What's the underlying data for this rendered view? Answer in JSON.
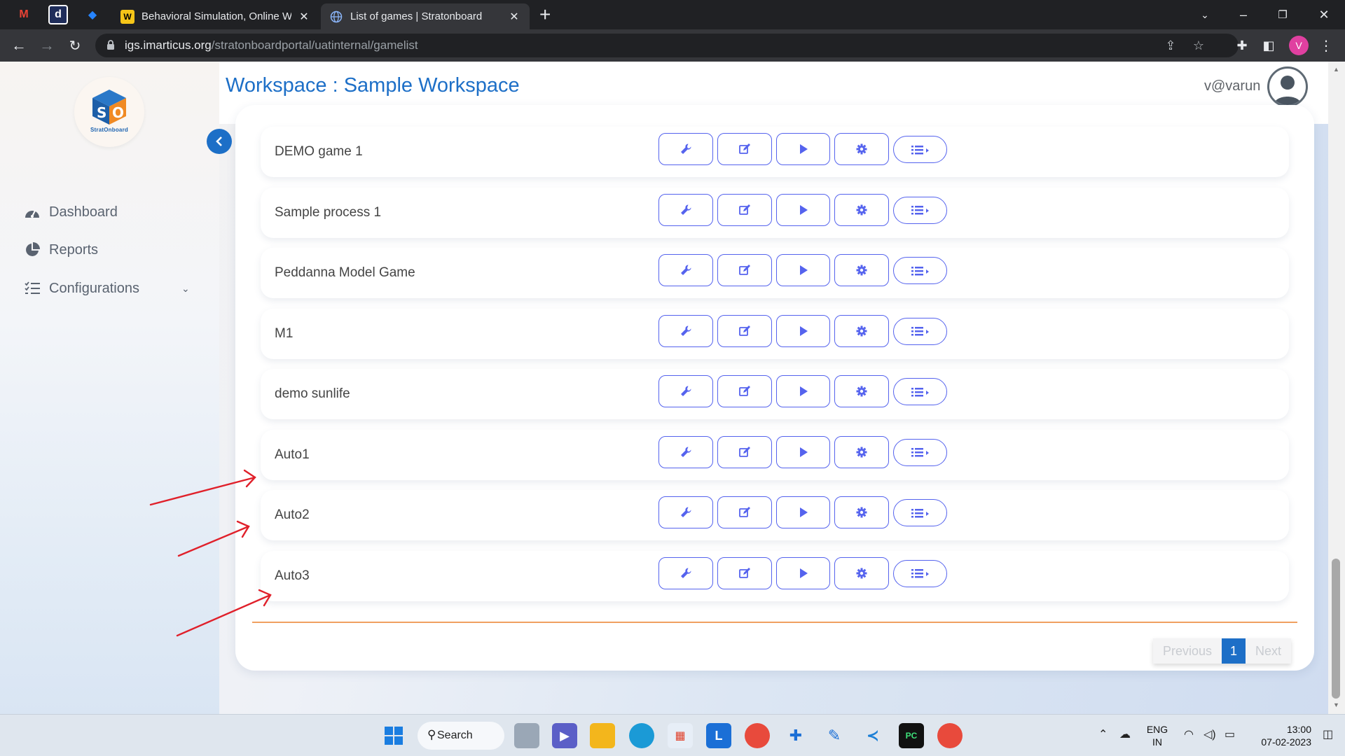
{
  "browser": {
    "pinned_tabs": [
      {
        "name": "gmail-icon",
        "glyph": "M",
        "color": "#ea4335"
      },
      {
        "name": "d-icon",
        "glyph": "d",
        "color": "#1f2d5a"
      },
      {
        "name": "jira-icon",
        "glyph": "◆",
        "color": "#2684ff"
      }
    ],
    "tabs": [
      {
        "title": "Behavioral Simulation, Online Wh",
        "close": "✕"
      },
      {
        "title": "List of games | Stratonboard",
        "close": "✕"
      }
    ],
    "new_tab": "+",
    "url_host": "igs.imarticus.org",
    "url_path": "/stratonboardportal/uatinternal/gamelist",
    "profile_initial": "V"
  },
  "app": {
    "brand": "StratOnboard",
    "workspace_title": "Workspace : Sample Workspace",
    "user": "v@varun"
  },
  "sidebar": {
    "items": [
      {
        "label": "Dashboard",
        "icon": "dashboard-icon"
      },
      {
        "label": "Reports",
        "icon": "pie-chart-icon"
      },
      {
        "label": "Configurations",
        "icon": "list-icon"
      }
    ]
  },
  "games": [
    {
      "name": "DEMO game 1"
    },
    {
      "name": "Sample process 1"
    },
    {
      "name": "Peddanna Model Game"
    },
    {
      "name": "M1"
    },
    {
      "name": "demo sunlife"
    },
    {
      "name": "Auto1"
    },
    {
      "name": "Auto2"
    },
    {
      "name": "Auto3"
    }
  ],
  "row_actions": [
    "wrench-icon",
    "edit-icon",
    "play-icon",
    "gear-icon",
    "list-menu-icon"
  ],
  "pagination": {
    "previous": "Previous",
    "current": "1",
    "next": "Next"
  },
  "taskbar": {
    "search_label": "Search",
    "lang_top": "ENG",
    "lang_bottom": "IN",
    "time": "13:00",
    "date": "07-02-2023"
  },
  "colors": {
    "accent_blue": "#1d6fc7",
    "action_purple": "#5563ee",
    "annotation_red": "#e0202a"
  }
}
